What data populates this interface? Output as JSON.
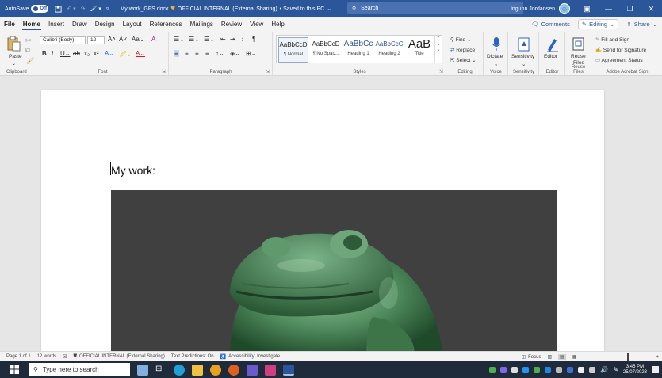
{
  "titlebar": {
    "autosave_label": "AutoSave",
    "autosave_state": "Off",
    "document_title": "My work_GFS.docx",
    "sensitivity": "OFFICIAL INTERNAL (External Sharing)",
    "save_status": "• Saved to this PC",
    "search_placeholder": "Search",
    "user_name": "Ingunn Jordansen"
  },
  "menu": {
    "tabs": [
      "File",
      "Home",
      "Insert",
      "Draw",
      "Design",
      "Layout",
      "References",
      "Mailings",
      "Review",
      "View",
      "Help"
    ],
    "active_tab": "Home",
    "comments_label": "Comments",
    "editing_label": "Editing",
    "share_label": "Share"
  },
  "ribbon": {
    "clipboard": {
      "paste_label": "Paste",
      "group_label": "Clipboard"
    },
    "font": {
      "font_name": "Calibri (Body)",
      "font_size": "12",
      "group_label": "Font"
    },
    "paragraph": {
      "group_label": "Paragraph"
    },
    "styles": {
      "group_label": "Styles",
      "tiles": [
        {
          "sample": "AaBbCcD",
          "name": "¶ Normal"
        },
        {
          "sample": "AaBbCcD",
          "name": "¶ No Spac..."
        },
        {
          "sample": "AaBbCc",
          "name": "Heading 1"
        },
        {
          "sample": "AaBbCcC",
          "name": "Heading 2"
        },
        {
          "sample": "AaB",
          "name": "Title"
        }
      ]
    },
    "editing": {
      "find": "Find",
      "replace": "Replace",
      "select": "Select",
      "group_label": "Editing"
    },
    "voice": {
      "dictate": "Dictate",
      "group_label": "Voice"
    },
    "sensitivity": {
      "label": "Sensitivity",
      "group_label": "Sensitivity"
    },
    "editor": {
      "label": "Editor",
      "group_label": "Editor"
    },
    "reuse": {
      "label_1": "Reuse",
      "label_2": "Files",
      "group_label": "Reuse Files"
    },
    "adobe": {
      "fill_sign": "Fill and Sign",
      "send_signature": "Send for Signature",
      "agreement_status": "Agreement Status",
      "group_label": "Adobe Acrobat Sign"
    }
  },
  "document": {
    "heading": "My work:"
  },
  "statusbar": {
    "page": "Page 1 of 1",
    "words": "12 words",
    "sensitivity": "OFFICIAL INTERNAL (External Sharing)",
    "predictions": "Text Predictions: On",
    "accessibility": "Accessibility: Investigate",
    "focus": "Focus"
  },
  "taskbar": {
    "search_placeholder": "Type here to search",
    "time": "3:45 PM",
    "date": "25/07/2023"
  }
}
